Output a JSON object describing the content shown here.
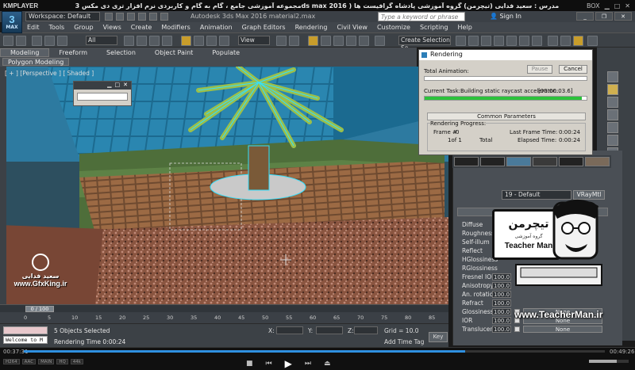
{
  "player": {
    "brand": "KMPLAYER",
    "title": "مجموعه آموزشی جامع ، گام به گام و کاربردی نرم افزار تری دی مکس 3ds max 2016 ) مدرس : سعید فدایی (تیچرمن) گروه آموزشی پادشاه گرافیست ها",
    "box_label": "BOX",
    "elapsed": "00:37:31",
    "total": "00:49:26",
    "progress": 0.76,
    "tags": [
      "H264",
      "AAC",
      "MAIN",
      "HQ",
      "44k"
    ]
  },
  "max": {
    "logo_top": "3",
    "logo_bottom": "MAX",
    "workspace": "Workspace: Default",
    "app_title": "Autodesk 3ds Max 2016     material2.max",
    "search_placeholder": "Type a keyword or phrase",
    "sign_in": "Sign In",
    "menus": [
      "Edit",
      "Tools",
      "Group",
      "Views",
      "Create",
      "Modifiers",
      "Animation",
      "Graph Editors",
      "Rendering",
      "Civil View",
      "Customize",
      "Scripting",
      "Help"
    ],
    "toolbar": {
      "filter": "All",
      "ref_coord": "View",
      "selection_set": "Create Selection Se"
    },
    "ribbon_tabs": [
      "Modeling",
      "Freeform",
      "Selection",
      "Object Paint",
      "Populate"
    ],
    "ribbon_sub": "Polygon Modeling",
    "viewport_label": "[ + ] [Perspective ] [ Shaded ]"
  },
  "render_dialog": {
    "title": "Rendering",
    "pause": "Pause",
    "cancel": "Cancel",
    "total_animation": "Total Animation:",
    "current_task_label": "Current Task:",
    "current_task": "Building static raycast accelerator...",
    "current_task_time": "[00:00:03.6]",
    "task_progress": 0.97,
    "common_params": "Common Parameters",
    "progress_title": "Rendering Progress:",
    "frame_label": "Frame #",
    "frame_value": "0",
    "of_label": "1of 1",
    "total_label": "Total",
    "last_frame_label": "Last Frame Time:",
    "last_frame_value": "0:00:24",
    "elapsed_label": "Elapsed Time:",
    "elapsed_value": "0:00:24"
  },
  "material": {
    "name": "19 - Default",
    "type": "VRayMtl",
    "options": "Options",
    "params": [
      {
        "label": "Diffuse"
      },
      {
        "label": "Roughness"
      },
      {
        "label": "Self-illum"
      },
      {
        "label": "Reflect"
      },
      {
        "label": "HGlossiness"
      },
      {
        "label": "RGlossiness"
      },
      {
        "label": "Fresnel IOR",
        "value": "100.0"
      },
      {
        "label": "Anisotropy",
        "value": "100.0"
      },
      {
        "label": "An. rotation",
        "value": "100.0"
      },
      {
        "label": "Refract",
        "value": "100.0"
      },
      {
        "label": "Glossiness",
        "value": "100.0",
        "map": "None"
      },
      {
        "label": "IOR",
        "value": "100.0",
        "map": "None"
      },
      {
        "label": "Translucent",
        "value": "100.0",
        "map": "None"
      }
    ]
  },
  "badge": {
    "fa": "تیچرمن",
    "sub": "گروه آموزشی",
    "en": "Teacher Man",
    "url": "www.TeacherMan.ir"
  },
  "watermark": {
    "fa": "سعید فدایی",
    "en": "www.GfxKing.ir"
  },
  "timeline": {
    "slider": "0 / 100",
    "ticks": [
      "0",
      "5",
      "10",
      "15",
      "20",
      "25",
      "30",
      "35",
      "40",
      "45",
      "50",
      "55",
      "60",
      "65",
      "70",
      "75",
      "80",
      "85"
    ]
  },
  "status": {
    "listener": "Welcome to M",
    "selected": "5 Objects Selected",
    "render_time": "Rendering Time  0:00:24",
    "x": "X:",
    "y": "Y:",
    "z": "Z:",
    "grid": "Grid = 10.0",
    "add_time_tag": "Add Time Tag",
    "key_btn": "Key"
  }
}
